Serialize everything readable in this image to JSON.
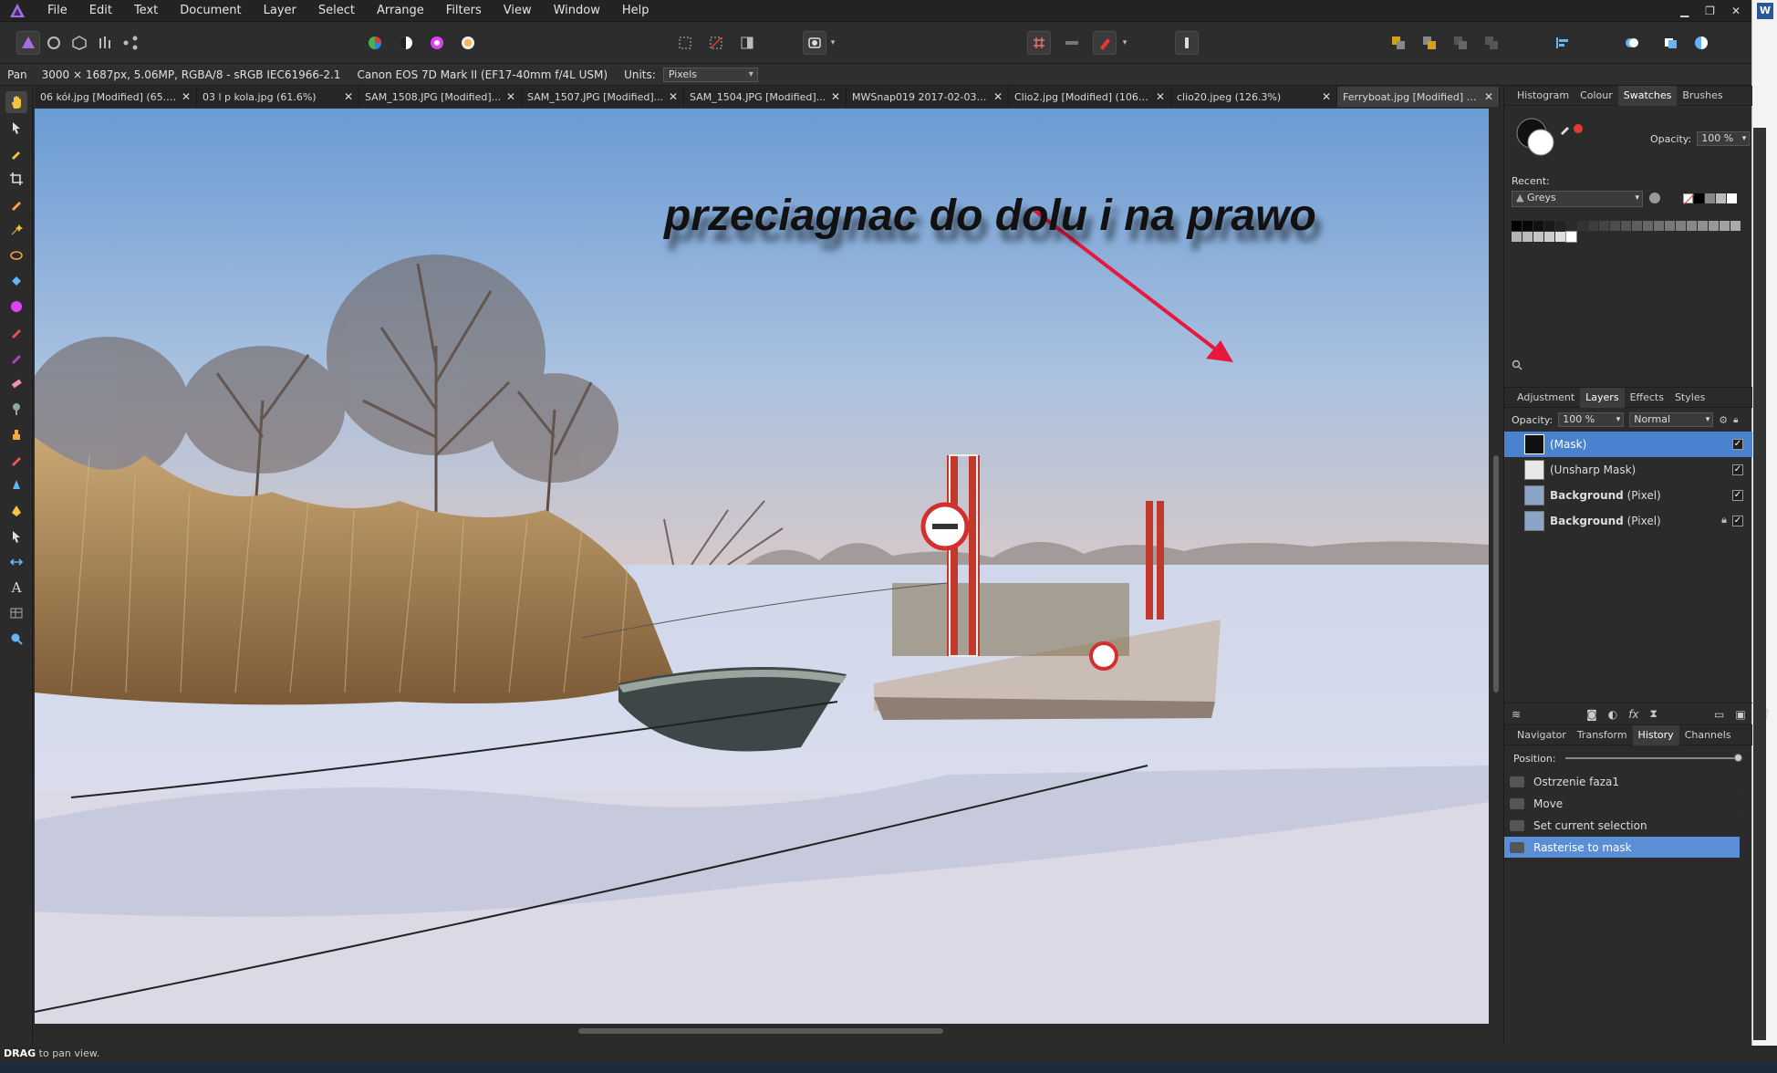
{
  "menu": [
    "File",
    "Edit",
    "Text",
    "Document",
    "Layer",
    "Select",
    "Arrange",
    "Filters",
    "View",
    "Window",
    "Help"
  ],
  "context": {
    "tool": "Pan",
    "doc_info": "3000 × 1687px, 5.06MP, RGBA/8 - sRGB IEC61966-2.1",
    "camera": "Canon EOS 7D Mark II (EF17-40mm f/4L USM)",
    "units_label": "Units:",
    "units_value": "Pixels"
  },
  "tabs": [
    {
      "label": "06 kół.jpg [Modified] (65.7..."
    },
    {
      "label": "03 l p kola.jpg (61.6%)"
    },
    {
      "label": "SAM_1508.JPG [Modified]..."
    },
    {
      "label": "SAM_1507.JPG [Modified]..."
    },
    {
      "label": "SAM_1504.JPG [Modified]..."
    },
    {
      "label": "MWSnap019 2017-02-03,..."
    },
    {
      "label": "Clio2.jpg [Modified] (106.1..."
    },
    {
      "label": "clio20.jpeg (126.3%)"
    },
    {
      "label": "Ferryboat.jpg [Modified] (..."
    }
  ],
  "annotation": "przeciagnac do dolu i na prawo",
  "top_panel": {
    "tabs": [
      "Histogram",
      "Colour",
      "Swatches",
      "Brushes"
    ],
    "active_tab": "Swatches",
    "opacity_label": "Opacity:",
    "opacity_value": "100 %",
    "recent_label": "Recent:",
    "palette": "Greys"
  },
  "layers_panel": {
    "tabs": [
      "Adjustment",
      "Layers",
      "Effects",
      "Styles"
    ],
    "active_tab": "Layers",
    "opacity_label": "Opacity:",
    "opacity_value": "100 %",
    "blend_mode": "Normal",
    "layers": [
      {
        "name": "(Mask)",
        "type": "",
        "selected": true
      },
      {
        "name": "(Unsharp Mask)",
        "type": "",
        "selected": false
      },
      {
        "name": "Background",
        "type": "(Pixel)",
        "selected": false
      },
      {
        "name": "Background",
        "type": "(Pixel)",
        "selected": false,
        "locked": true
      }
    ]
  },
  "history_panel": {
    "tabs": [
      "Navigator",
      "Transform",
      "History",
      "Channels"
    ],
    "active_tab": "History",
    "position_label": "Position:",
    "items": [
      "Ostrzenie faza1",
      "Move",
      "Set current selection",
      "Rasterise to mask"
    ],
    "selected_index": 3
  },
  "status": {
    "key": "DRAG",
    "text": "to pan view."
  },
  "colors": {
    "accent": "#4a82cf",
    "arrow": "#e8173d",
    "history_selected": "#5a8fd8"
  }
}
